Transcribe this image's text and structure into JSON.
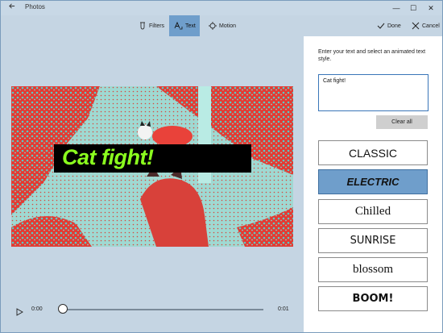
{
  "app": {
    "title": "Photos"
  },
  "window_controls": {
    "minimize": "—",
    "maximize": "☐",
    "close": "✕"
  },
  "toolbar": {
    "filters_label": "Filters",
    "text_label": "Text",
    "motion_label": "Motion",
    "done_label": "Done",
    "cancel_label": "Cancel",
    "active_tool": "Text",
    "accent_color": "#6f9ecb"
  },
  "canvas": {
    "caption_text": "Cat fight!",
    "caption_color": "#8bff1e",
    "caption_background": "#000000"
  },
  "playback": {
    "current_time": "0:00",
    "end_time": "0:01",
    "progress": 0
  },
  "panel": {
    "instructions": "Enter your text and select an animated text style.",
    "input_value": "Cat fight!",
    "clear_label": "Clear all",
    "styles": [
      {
        "label": "CLASSIC",
        "selected": false
      },
      {
        "label": "ELECTRIC",
        "selected": true
      },
      {
        "label": "Chilled",
        "selected": false
      },
      {
        "label": "SUNRISE",
        "selected": false
      },
      {
        "label": "blossom",
        "selected": false
      },
      {
        "label": "BOOM!",
        "selected": false
      }
    ]
  }
}
